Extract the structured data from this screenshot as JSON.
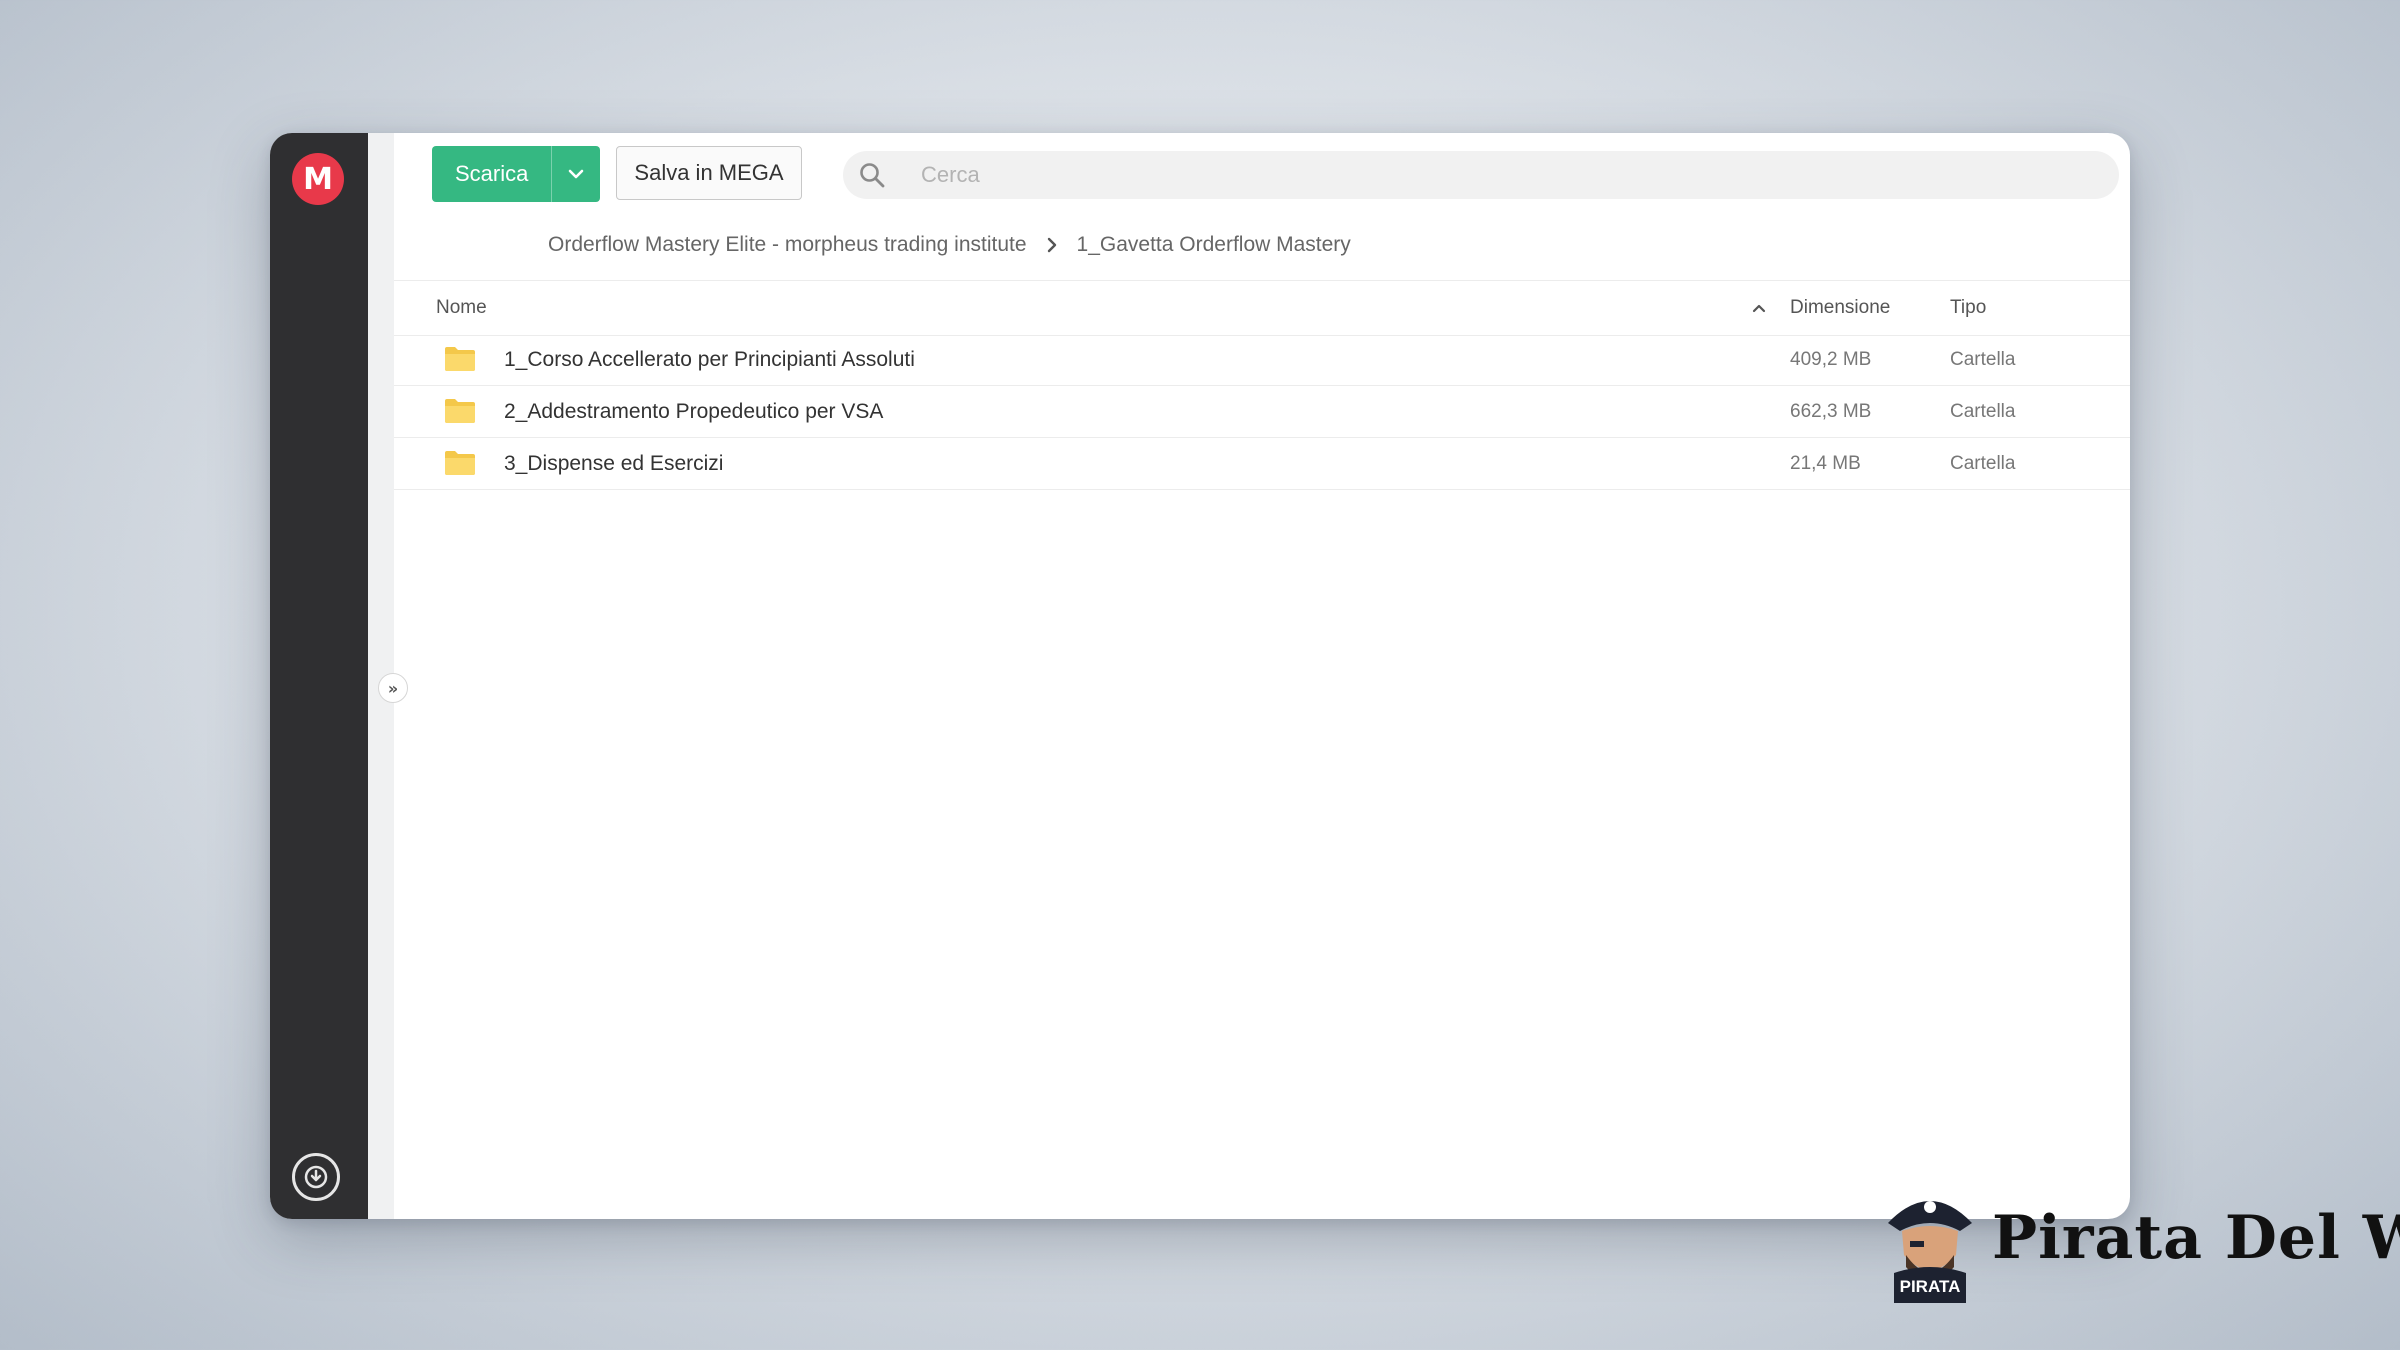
{
  "app": {
    "logo_letter": "M",
    "logo_color": "#e8394a",
    "accent_color": "#35b882"
  },
  "toolbar": {
    "download_label": "Scarica",
    "save_label": "Salva in MEGA",
    "search_placeholder": "Cerca"
  },
  "breadcrumb": {
    "items": [
      "Orderflow Mastery Elite - morpheus trading institute",
      "1_Gavetta Orderflow Mastery"
    ]
  },
  "table": {
    "columns": {
      "name": "Nome",
      "size": "Dimensione",
      "type": "Tipo"
    },
    "sort": "name-ascending",
    "rows": [
      {
        "name": "1_Corso Accellerato per Principianti Assoluti",
        "size": "409,2 MB",
        "type": "Cartella",
        "icon": "folder-icon"
      },
      {
        "name": "2_Addestramento Propedeutico per VSA",
        "size": "662,3 MB",
        "type": "Cartella",
        "icon": "folder-icon"
      },
      {
        "name": "3_Dispense ed Esercizi",
        "size": "21,4 MB",
        "type": "Cartella",
        "icon": "folder-icon"
      }
    ]
  },
  "brand": {
    "title": "Pirata Del Web",
    "badge": "PIRATA"
  }
}
